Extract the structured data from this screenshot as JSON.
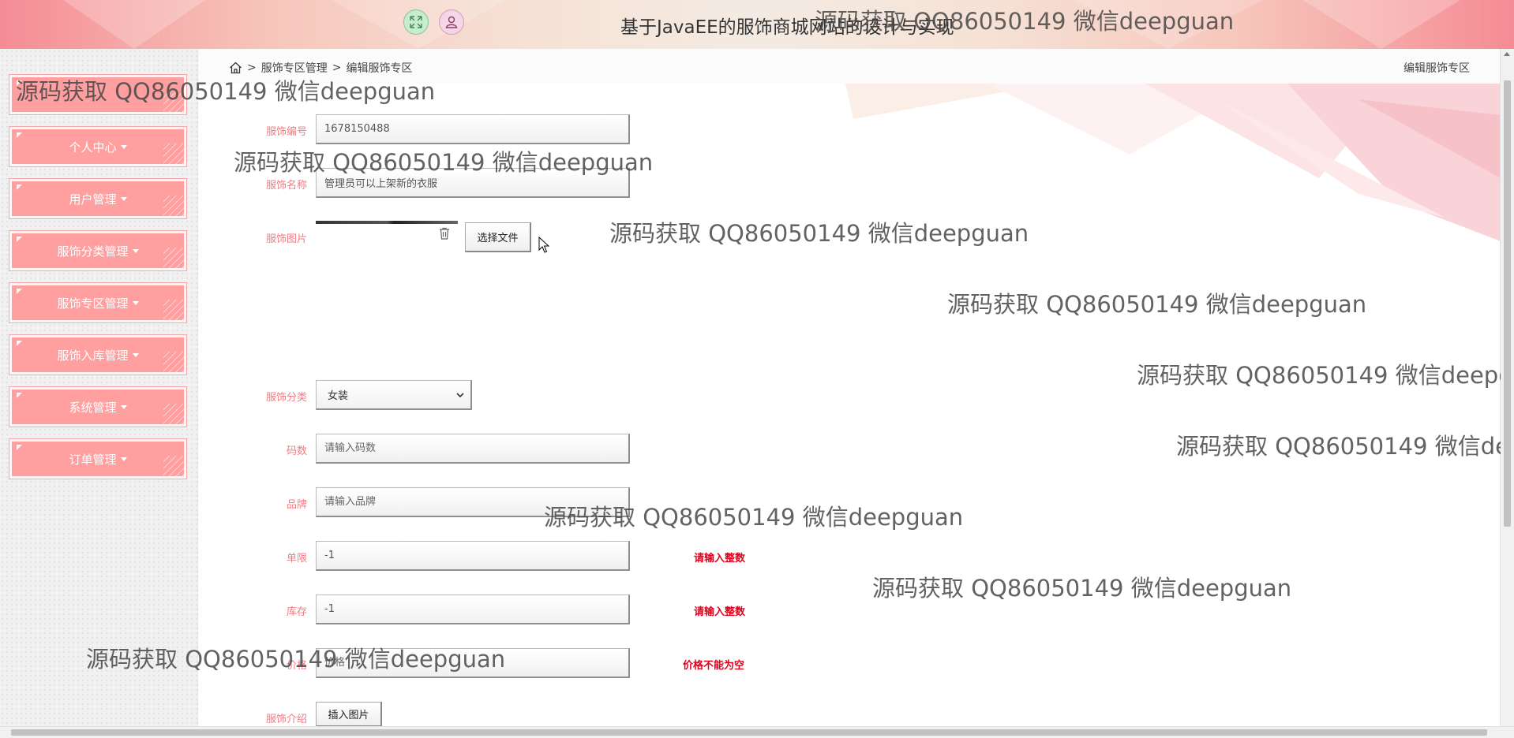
{
  "header": {
    "title": "基于JavaEE的服饰商城网站的设计与实现",
    "expand_icon": "expand-icon",
    "user_icon": "user-icon"
  },
  "sidebar": {
    "items": [
      {
        "label": ""
      },
      {
        "label": "个人中心"
      },
      {
        "label": "用户管理"
      },
      {
        "label": "服饰分类管理"
      },
      {
        "label": "服饰专区管理"
      },
      {
        "label": "服饰入库管理"
      },
      {
        "label": "系统管理"
      },
      {
        "label": "订单管理"
      }
    ]
  },
  "breadcrumb": {
    "home_icon": "home-icon",
    "sep": ">",
    "level1": "服饰专区管理",
    "level2": "编辑服饰专区",
    "page_title": "编辑服饰专区"
  },
  "form": {
    "code": {
      "label": "服饰编号",
      "value": "1678150488"
    },
    "name": {
      "label": "服饰名称",
      "value": "管理员可以上架新的衣服"
    },
    "image": {
      "label": "服饰图片",
      "choose_file": "选择文件",
      "delete_icon": "trash-icon"
    },
    "category": {
      "label": "服饰分类",
      "selected": "女装"
    },
    "size": {
      "label": "码数",
      "placeholder": "请输入码数"
    },
    "brand": {
      "label": "品牌",
      "placeholder": "请输入品牌"
    },
    "limit": {
      "label": "单限",
      "value": "-1",
      "error": "请输入整数"
    },
    "stock": {
      "label": "库存",
      "value": "-1",
      "error": "请输入整数"
    },
    "price": {
      "label": "价格",
      "placeholder": "价格",
      "error": "价格不能为空"
    },
    "intro": {
      "label": "服饰介绍",
      "insert_image": "插入图片"
    }
  },
  "watermark": "源码获取 QQ86050149 微信deepguan",
  "colors": {
    "accent": "#ff9fa0",
    "label": "#f07b82",
    "error": "#e0001b"
  }
}
